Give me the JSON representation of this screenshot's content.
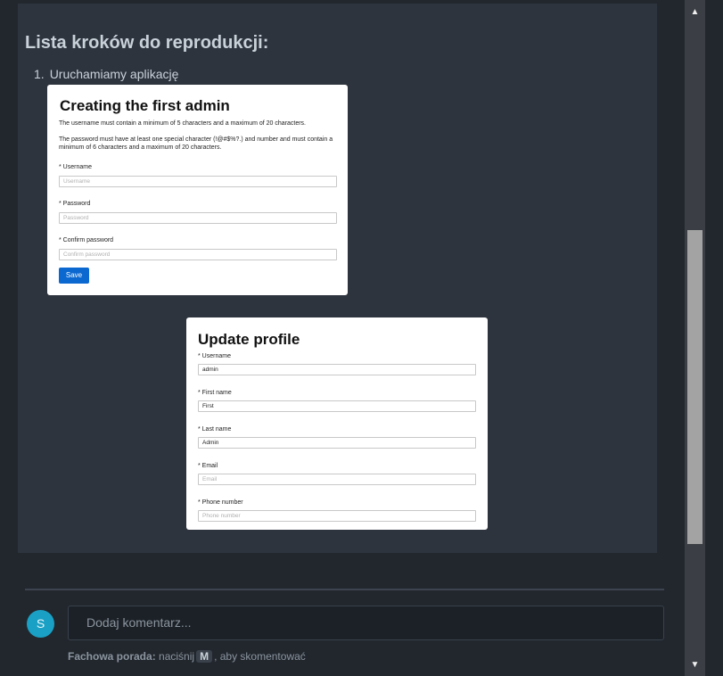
{
  "section": {
    "title": "Lista kroków do reprodukcji:",
    "step_number": "1.",
    "step_text": "Uruchamiamy aplikację"
  },
  "screenshot_admin": {
    "title": "Creating the first admin",
    "rule_username": "The username must contain a minimum of 5 characters and a maximum of 20 characters.",
    "rule_password": "The password must have at least one special character (!@#$%?.) and number and must contain a minimum of 6 characters and a maximum of 20 characters.",
    "username_label": "* Username",
    "username_placeholder": "Username",
    "password_label": "* Password",
    "password_placeholder": "Password",
    "confirm_label": "* Confirm password",
    "confirm_placeholder": "Confirm password",
    "save_label": "Save"
  },
  "screenshot_profile": {
    "title": "Update profile",
    "username_label": "* Username",
    "username_value": "admin",
    "first_name_label": "* First name",
    "first_name_value": "First",
    "last_name_label": "* Last name",
    "last_name_value": "Admin",
    "email_label": "* Email",
    "email_placeholder": "Email",
    "phone_label": "* Phone number",
    "phone_placeholder": "Phone number"
  },
  "comment": {
    "avatar_initial": "S",
    "placeholder": "Dodaj komentarz...",
    "tip_bold": "Fachowa porada:",
    "tip_before": "naciśnij",
    "tip_key": "M",
    "tip_after": ", aby skomentować"
  },
  "colors": {
    "background": "#22272e",
    "panel": "#2e343e",
    "avatar": "#1aa0c4",
    "save_button": "#0b68d0"
  },
  "icons": {
    "scroll_up": "triangle-up",
    "scroll_down": "triangle-down"
  }
}
